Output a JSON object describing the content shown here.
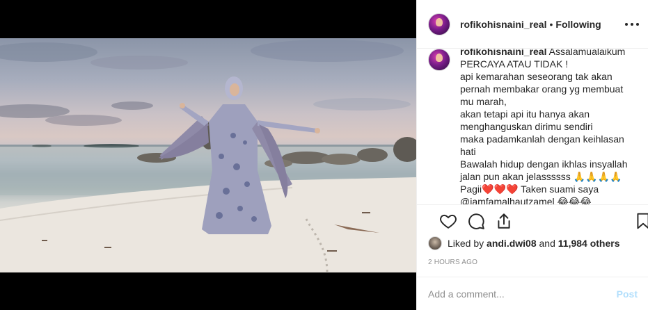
{
  "post": {
    "username": "rofikohisnaini_real",
    "follow_status": "Following",
    "separator": "•"
  },
  "caption": {
    "username": "rofikohisnaini_real",
    "first_line": "Assalamualaikum",
    "lines": [
      "PERCAYA ATAU TIDAK !",
      "api kemarahan seseorang tak akan",
      "pernah membakar orang yg membuat",
      "mu marah,",
      "akan tetapi api itu hanya akan",
      "menghanguskan dirimu sendiri",
      "maka padamkanlah dengan keihlasan",
      "hati",
      "Bawalah hidup dengan ikhlas insyallah",
      "jalan pun akan jelassssss 🙏🙏🙏🙏",
      "Pagii❤️❤️❤️ Taken suami saya",
      "@iamfamalhautzamel 😂😂😂"
    ]
  },
  "likes": {
    "prefix": "Liked by",
    "user": "andi.dwi08",
    "joiner": "and",
    "others": "11,984 others"
  },
  "timestamp": "2 hours ago",
  "comment_box": {
    "placeholder": "Add a comment...",
    "post_label": "Post"
  },
  "icons": {
    "like": "heart-icon",
    "comment": "comment-icon",
    "share": "share-icon",
    "save": "bookmark-icon",
    "more": "more-options-icon"
  },
  "colors": {
    "post_disabled": "#b2dffc",
    "muted": "#8e8e8e",
    "text": "#262626"
  }
}
